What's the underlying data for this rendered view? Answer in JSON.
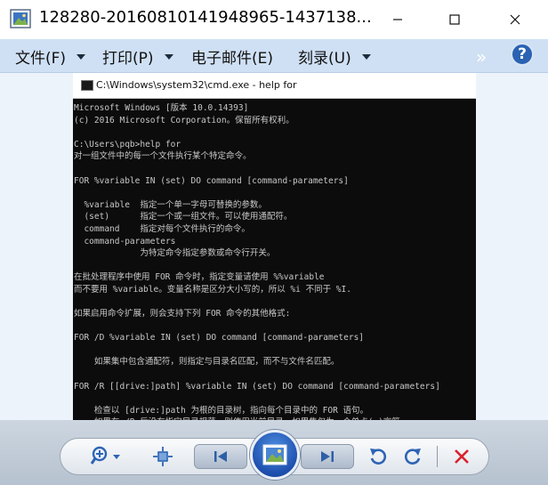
{
  "window": {
    "title": "128280-20160810141948965-1437138..."
  },
  "menu": {
    "items": [
      {
        "label": "文件(F)",
        "has_dropdown": true
      },
      {
        "label": "打印(P)",
        "has_dropdown": true
      },
      {
        "label": "电子邮件(E)",
        "has_dropdown": false
      },
      {
        "label": "刻录(U)",
        "has_dropdown": true
      }
    ],
    "help_label": "?"
  },
  "image": {
    "cmd_title": "C:\\Windows\\system32\\cmd.exe - help  for",
    "console_lines": [
      "Microsoft Windows [版本 10.0.14393]",
      "(c) 2016 Microsoft Corporation。保留所有权利。",
      "",
      "C:\\Users\\pqb>help for",
      "对一组文件中的每一个文件执行某个特定命令。",
      "",
      "FOR %variable IN (set) DO command [command-parameters]",
      "",
      "  %variable  指定一个单一字母可替换的参数。",
      "  (set)      指定一个或一组文件。可以使用通配符。",
      "  command    指定对每个文件执行的命令。",
      "  command-parameters",
      "             为特定命令指定参数或命令行开关。",
      "",
      "在批处理程序中使用 FOR 命令时，指定变量请使用 %%variable",
      "而不要用 %variable。变量名称是区分大小写的，所以 %i 不同于 %I.",
      "",
      "如果启用命令扩展，则会支持下列 FOR 命令的其他格式:",
      "",
      "FOR /D %variable IN (set) DO command [command-parameters]",
      "",
      "    如果集中包含通配符，则指定与目录名匹配，而不与文件名匹配。",
      "",
      "FOR /R [[drive:]path] %variable IN (set) DO command [command-parameters]",
      "",
      "    检查以 [drive:]path 为根的目录树，指向每个目录中的 FOR 语句。",
      "    如果在 /R 后没有指定目录规范，则使用当前目录。如果集仅为一个单点(.)字符"
    ]
  },
  "colors": {
    "menubar": "#cfe0f4",
    "console_bg": "#0c0c0c",
    "console_text": "#c8c8c8",
    "accent": "#2b62b2",
    "close_red": "#d9232e"
  },
  "icons": {
    "app": "photo-viewer-icon",
    "minimize": "minimize-icon",
    "maximize": "maximize-icon",
    "close": "close-icon",
    "zoom": "zoom-icon",
    "actual_size": "actual-size-icon",
    "previous": "previous-icon",
    "slideshow": "slideshow-icon",
    "next": "next-icon",
    "rotate_ccw": "rotate-counterclockwise-icon",
    "rotate_cw": "rotate-clockwise-icon",
    "delete": "delete-icon"
  }
}
